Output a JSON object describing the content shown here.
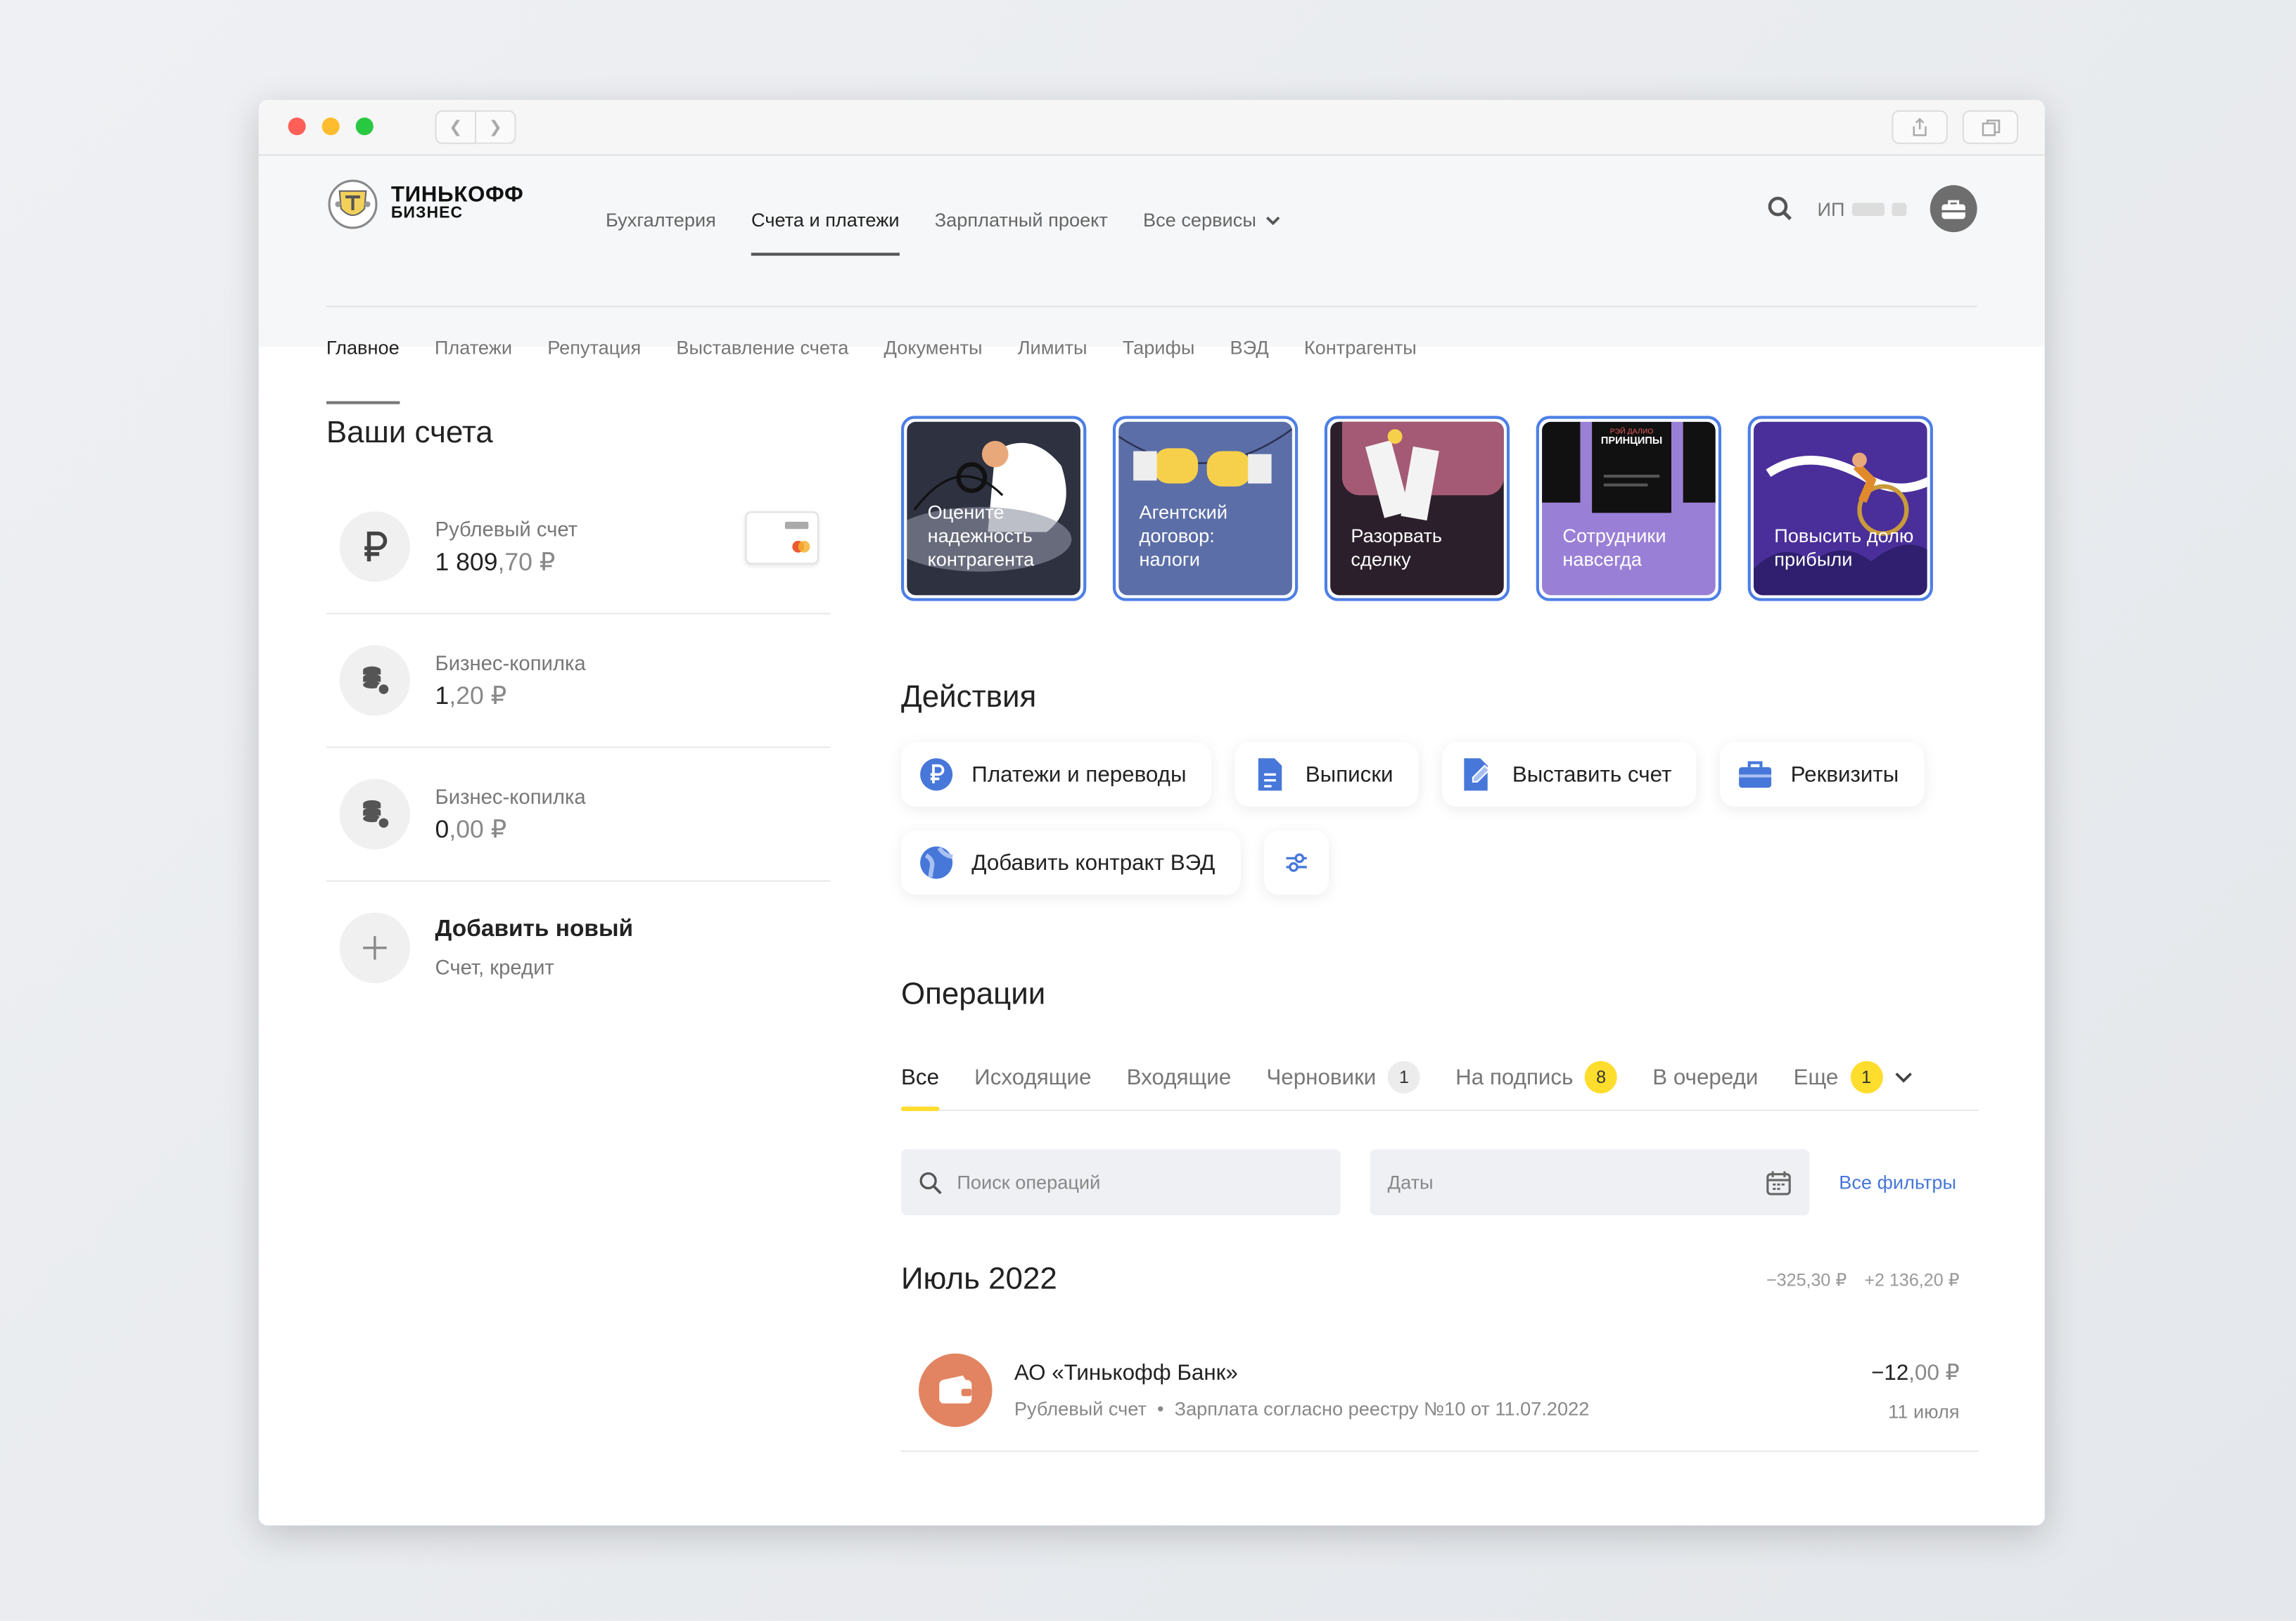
{
  "brand": {
    "line1": "ТИНЬКОФФ",
    "line2": "БИЗНЕС"
  },
  "topnav": [
    {
      "label": "Бухгалтерия"
    },
    {
      "label": "Счета и платежи"
    },
    {
      "label": "Зарплатный проект"
    },
    {
      "label": "Все сервисы"
    }
  ],
  "user": {
    "prefix": "ИП"
  },
  "subnav": [
    {
      "label": "Главное"
    },
    {
      "label": "Платежи"
    },
    {
      "label": "Репутация"
    },
    {
      "label": "Выставление счета"
    },
    {
      "label": "Документы"
    },
    {
      "label": "Лимиты"
    },
    {
      "label": "Тарифы"
    },
    {
      "label": "ВЭД"
    },
    {
      "label": "Контрагенты"
    }
  ],
  "accounts": {
    "title": "Ваши счета",
    "items": [
      {
        "name": "Рублевый счет",
        "int": "1 809",
        "frac": ",70 ₽"
      },
      {
        "name": "Бизнес-копилка",
        "int": "1",
        "frac": ",20 ₽"
      },
      {
        "name": "Бизнес-копилка",
        "int": "0",
        "frac": ",00 ₽"
      }
    ],
    "add": {
      "title": "Добавить новый",
      "subtitle": "Счет, кредит"
    }
  },
  "stories": [
    {
      "text": "Оцените надежность контрагента",
      "bg": "#2d3140"
    },
    {
      "text": "Агентский договор: налоги",
      "bg": "#5b6ea8"
    },
    {
      "text": "Разорвать сделку",
      "bg": "#2a1f2b"
    },
    {
      "text": "Сотрудники навсегда",
      "bg": "#9a7fd6",
      "caption_top": "РЭЙ ДАЛИО",
      "caption_main": "ПРИНЦИПЫ"
    },
    {
      "text": "Повысить долю прибыли",
      "bg": "#4a2f9a"
    }
  ],
  "actions": {
    "title": "Действия",
    "items": [
      {
        "label": "Платежи и переводы",
        "icon": "ruble-circle-icon"
      },
      {
        "label": "Выписки",
        "icon": "document-icon"
      },
      {
        "label": "Выставить счет",
        "icon": "invoice-icon"
      },
      {
        "label": "Реквизиты",
        "icon": "briefcase-icon"
      },
      {
        "label": "Добавить контракт ВЭД",
        "icon": "globe-icon"
      }
    ]
  },
  "operations": {
    "title": "Операции",
    "tabs": [
      {
        "label": "Все"
      },
      {
        "label": "Исходящие"
      },
      {
        "label": "Входящие"
      },
      {
        "label": "Черновики",
        "badge": "1"
      },
      {
        "label": "На подпись",
        "badge": "8"
      },
      {
        "label": "В очереди"
      },
      {
        "label": "Еще",
        "badge": "1"
      }
    ],
    "search_placeholder": "Поиск операций",
    "dates_placeholder": "Даты",
    "all_filters": "Все фильтры",
    "month": "Июль 2022",
    "sum_out": "−325,30 ₽",
    "sum_in": "+2 136,20 ₽",
    "items": [
      {
        "name": "АО «Тинькофф Банк»",
        "account": "Рублевый счет",
        "description": "Зарплата согласно реестру №10 от 11.07.2022",
        "amount_int": "−12",
        "amount_frac": ",00 ₽",
        "date": "11 июля"
      }
    ]
  },
  "colors": {
    "accent": "#ffdd2d",
    "link": "#4777d9",
    "story_border": "#4d7fe6"
  }
}
